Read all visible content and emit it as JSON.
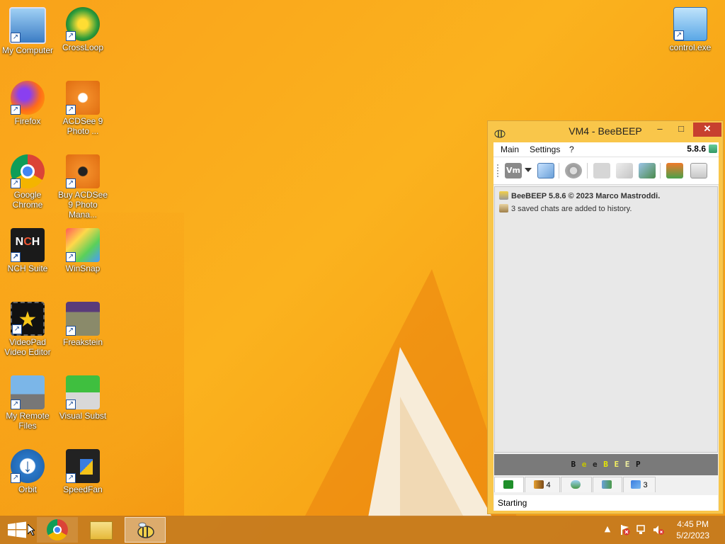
{
  "desktop": {
    "icons": [
      {
        "label": "My Computer",
        "icon": "computer-icon"
      },
      {
        "label": "CrossLoop",
        "icon": "crossloop-icon"
      },
      {
        "label": "Firefox",
        "icon": "firefox-icon"
      },
      {
        "label": "ACDSee 9 Photo ...",
        "icon": "acdsee-icon"
      },
      {
        "label": "Google Chrome",
        "icon": "chrome-icon"
      },
      {
        "label": "Buy ACDSee 9 Photo Mana...",
        "icon": "acdsee-buy-icon"
      },
      {
        "label": "NCH Suite",
        "icon": "nch-icon"
      },
      {
        "label": "WinSnap",
        "icon": "winsnap-icon"
      },
      {
        "label": "VideoPad Video Editor",
        "icon": "videopad-icon"
      },
      {
        "label": "Freakstein",
        "icon": "freakstein-icon"
      },
      {
        "label": "My Remote Files",
        "icon": "remote-files-icon"
      },
      {
        "label": "Visual Subst",
        "icon": "visual-subst-icon"
      },
      {
        "label": "Orbit",
        "icon": "orbit-icon"
      },
      {
        "label": "SpeedFan",
        "icon": "speedfan-icon"
      },
      {
        "label": "control.exe",
        "icon": "control-panel-icon"
      }
    ]
  },
  "window": {
    "title": "VM4 - BeeBEEP",
    "minimize": "–",
    "maximize": "□",
    "close": "✕",
    "menu": {
      "main": "Main",
      "settings": "Settings",
      "help": "?",
      "version": "5.8.6"
    },
    "toolbar": {
      "profile": "Vm"
    },
    "chat_lines": [
      {
        "text": "BeeBEEP 5.8.6 © 2023 Marco Mastroddi.",
        "bold": true
      },
      {
        "text": "3 saved chats are added to history.",
        "bold": false
      }
    ],
    "banner": {
      "letters": [
        "B",
        "e",
        "e",
        "B",
        "E",
        "E",
        "P"
      ]
    },
    "tabs": [
      {
        "label": ""
      },
      {
        "label": "4"
      },
      {
        "label": ""
      },
      {
        "label": ""
      },
      {
        "label": "3"
      }
    ],
    "status": "Starting"
  },
  "taskbar": {
    "time": "4:45 PM",
    "date": "5/2/2023",
    "tray_expand": "▲"
  },
  "colors": {
    "accent": "#f9c64a",
    "close_red": "#c7402f",
    "taskbar": "#c47a1e"
  }
}
